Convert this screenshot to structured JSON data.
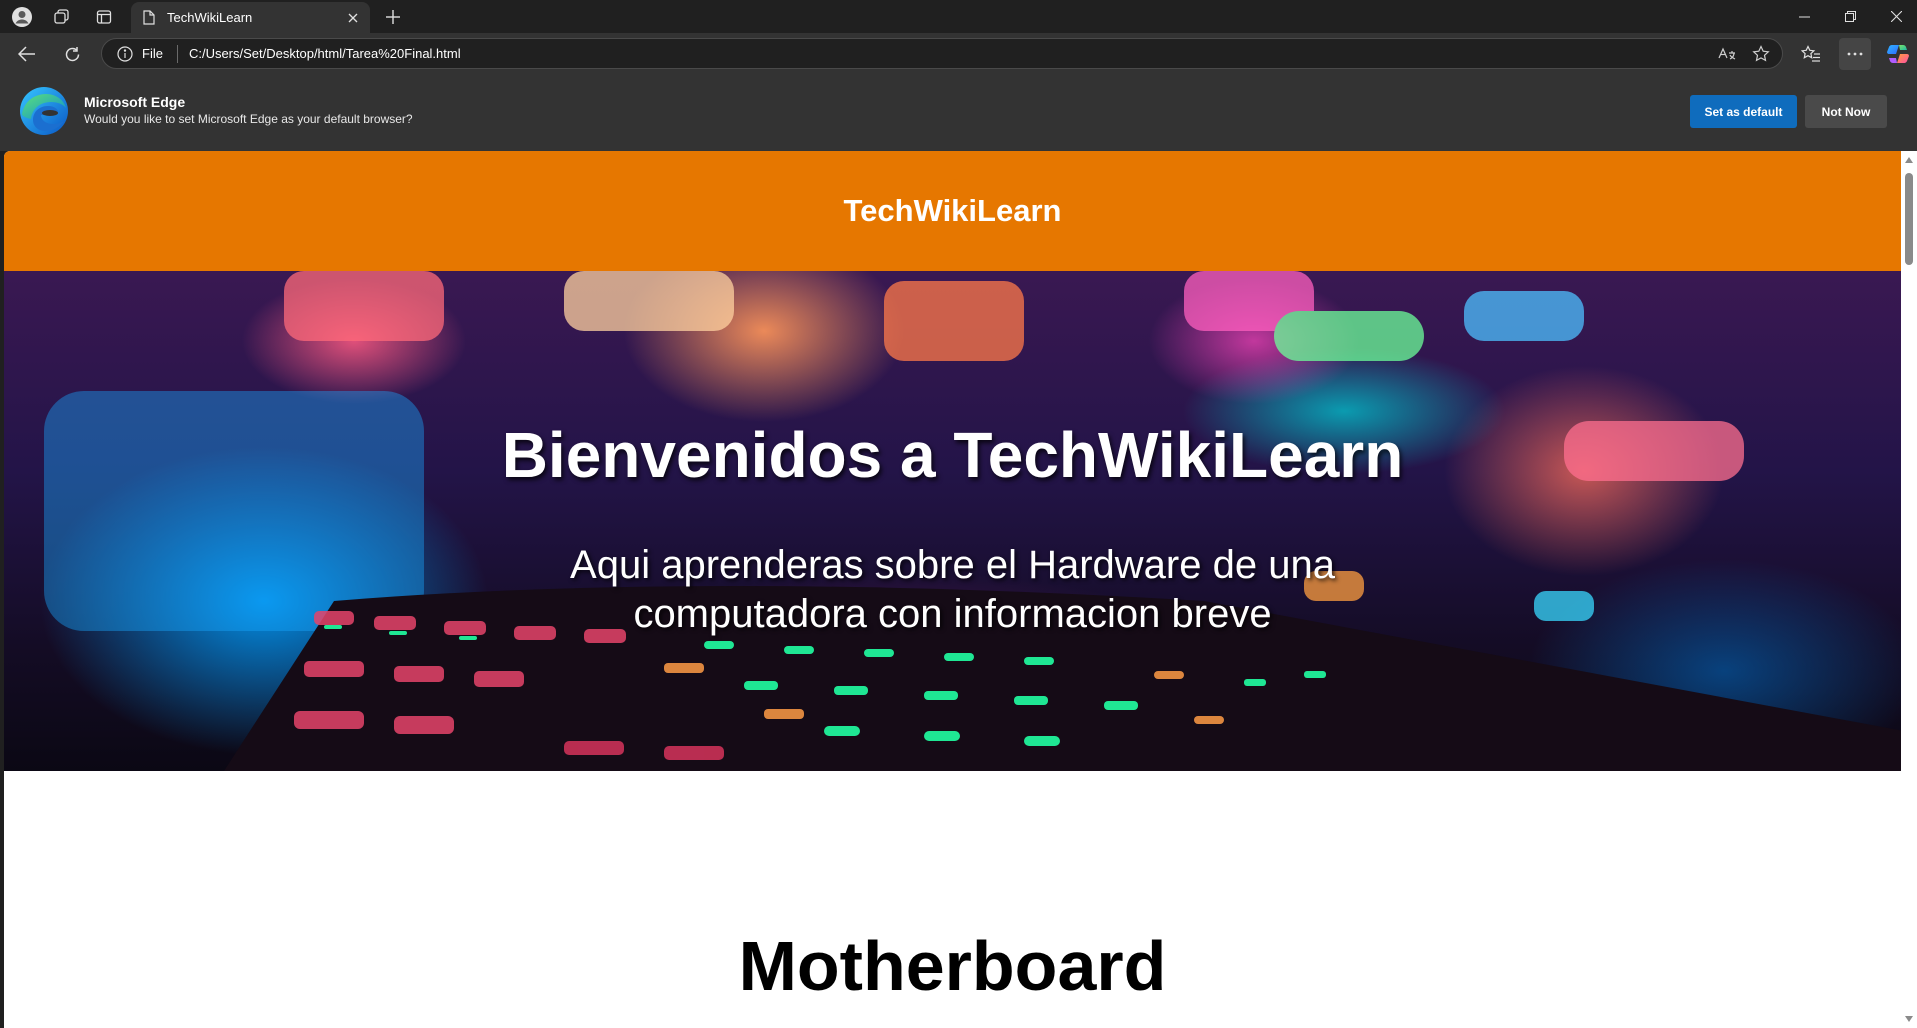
{
  "browser": {
    "tab": {
      "title": "TechWikiLearn"
    },
    "omnibox": {
      "scheme": "File",
      "url": "C:/Users/Set/Desktop/html/Tarea%20Final.html"
    },
    "icons": {
      "profile": "profile-icon",
      "workspaces": "workspaces-icon",
      "vertical_tabs": "vertical-tabs-icon",
      "new_tab": "plus-icon",
      "back": "back-arrow-icon",
      "refresh": "refresh-icon",
      "info": "info-icon",
      "read_aloud": "read-aloud-icon",
      "favorite": "star-icon",
      "favorites": "favorites-icon",
      "more": "more-icon",
      "copilot": "copilot-icon"
    }
  },
  "infobar": {
    "title": "Microsoft Edge",
    "message": "Would you like to set Microsoft Edge as your default browser?",
    "primary_button": "Set as default",
    "secondary_button": "Not Now"
  },
  "page": {
    "header_title": "TechWikiLearn",
    "hero": {
      "title": "Bienvenidos a TechWikiLearn",
      "subtitle_line1": "Aqui aprenderas sobre el Hardware de una",
      "subtitle_line2": "computadora con informacion breve"
    },
    "section_title": "Motherboard"
  },
  "colors": {
    "header_bg": "#e67700",
    "primary_button": "#0f6cbd",
    "browser_chrome": "#333333"
  }
}
